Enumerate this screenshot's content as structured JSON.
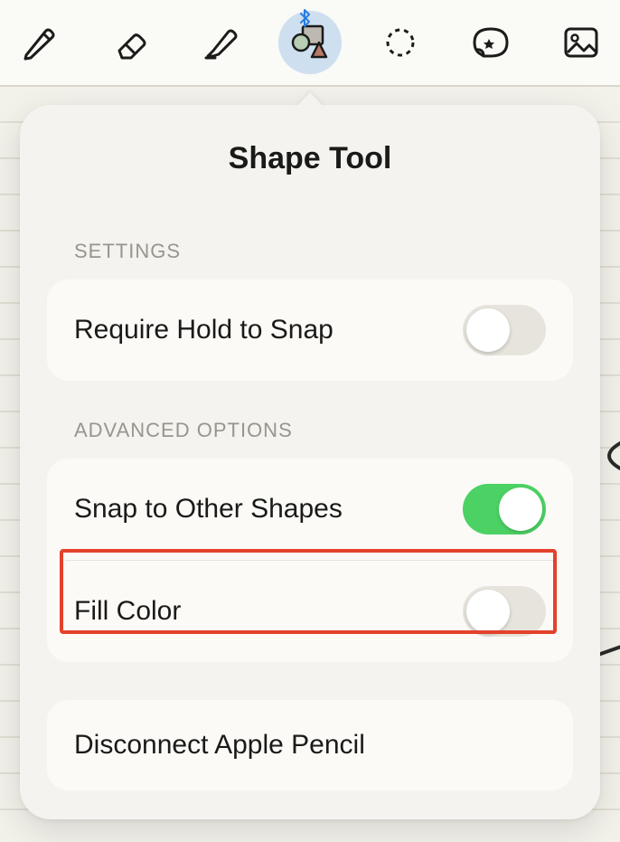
{
  "toolbar": {
    "items": [
      {
        "name": "pen-tool-icon",
        "active": false
      },
      {
        "name": "eraser-tool-icon",
        "active": false
      },
      {
        "name": "highlighter-tool-icon",
        "active": false
      },
      {
        "name": "shape-tool-icon",
        "active": true,
        "bluetooth_badge": "✱"
      },
      {
        "name": "lasso-tool-icon",
        "active": false
      },
      {
        "name": "sticker-tool-icon",
        "active": false
      },
      {
        "name": "image-tool-icon",
        "active": false
      }
    ]
  },
  "popover": {
    "title": "Shape Tool",
    "sections": {
      "settings_header": "SETTINGS",
      "advanced_header": "ADVANCED OPTIONS"
    },
    "rows": {
      "require_hold": {
        "label": "Require Hold to Snap",
        "on": false
      },
      "snap_shapes": {
        "label": "Snap to Other Shapes",
        "on": true
      },
      "fill_color": {
        "label": "Fill Color",
        "on": false
      },
      "disconnect": {
        "label": "Disconnect Apple Pencil"
      }
    }
  },
  "colors": {
    "accent_on": "#4cd264",
    "highlight": "#e4412b"
  }
}
